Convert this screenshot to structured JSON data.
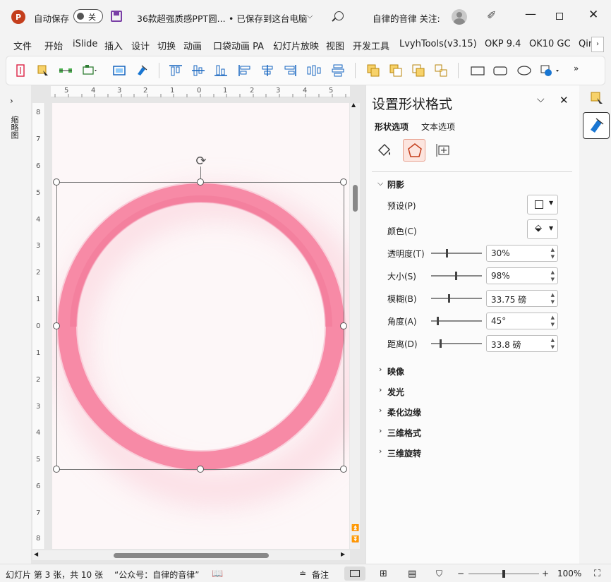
{
  "titlebar": {
    "autosave_label": "自动保存",
    "autosave_state": "关",
    "doc_title": "36款超强质感PPT圆...",
    "save_status": "• 已保存到这台电脑",
    "user_label": "自律的音律 关注:",
    "brand_color": "#c43e1c"
  },
  "menu": [
    "文件",
    "开始",
    "iSlide",
    "插入",
    "设计",
    "切换",
    "动画",
    "口袋动画 PA",
    "幻灯片放映",
    "视图",
    "开发工具",
    "LvyhTools(v3.15)",
    "OKP 9.4",
    "OK10 GC",
    "Qir"
  ],
  "left_strip": {
    "label": "缩略图"
  },
  "ruler": {
    "h_ticks": [
      "5",
      "4",
      "3",
      "2",
      "1",
      "0",
      "1",
      "2",
      "3",
      "4",
      "5"
    ],
    "v_ticks": [
      "8",
      "7",
      "6",
      "5",
      "4",
      "3",
      "2",
      "1",
      "0",
      "1",
      "2",
      "3",
      "4",
      "5",
      "6",
      "7",
      "8"
    ]
  },
  "panel": {
    "title": "设置形状格式",
    "tab_shape": "形状选项",
    "tab_text": "文本选项",
    "shadow": {
      "header": "阴影",
      "preset_label": "预设(P)",
      "color_label": "颜色(C)",
      "transparency_label": "透明度(T)",
      "transparency_value": "30%",
      "transparency_level": 0.3,
      "size_label": "大小(S)",
      "size_value": "98%",
      "size_level": 0.49,
      "blur_label": "模糊(B)",
      "blur_value": "33.75 磅",
      "blur_level": 0.34,
      "angle_label": "角度(A)",
      "angle_value": "45°",
      "angle_level": 0.12,
      "distance_label": "距离(D)",
      "distance_value": "33.8 磅",
      "distance_level": 0.17
    },
    "sections": [
      "映像",
      "发光",
      "柔化边缘",
      "三维格式",
      "三维旋转"
    ]
  },
  "statusbar": {
    "slide_info": "幻灯片 第 3 张，共 10 张",
    "author": "“公众号：自律的音律”",
    "notes": "备注",
    "zoom": "100%"
  },
  "colors": {
    "ring": "#f78aa6",
    "ring_dark": "#f27a9a"
  }
}
